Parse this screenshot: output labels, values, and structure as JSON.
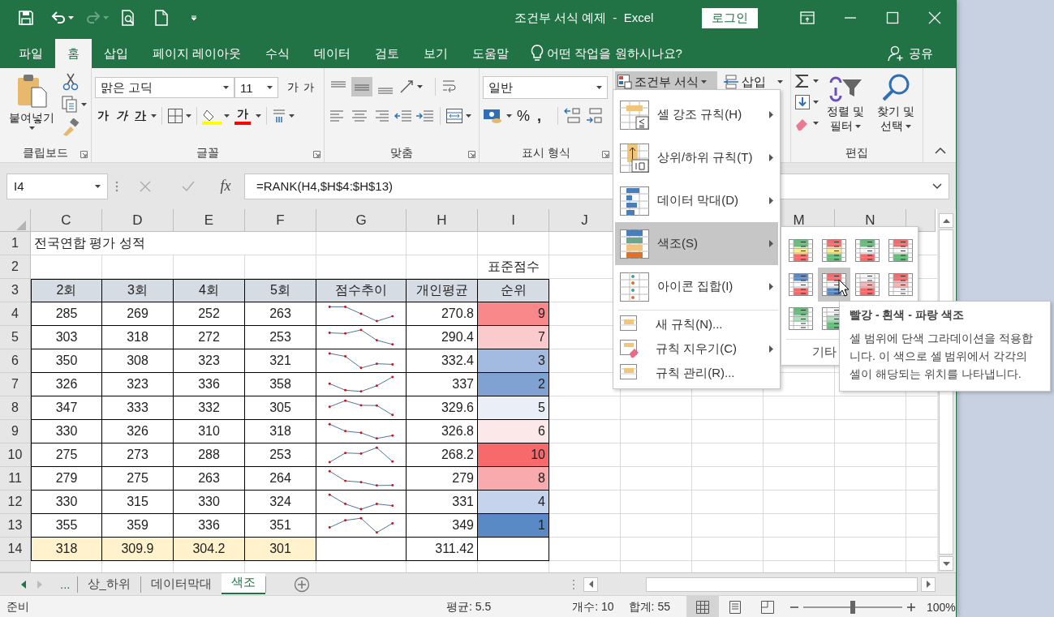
{
  "window": {
    "title": "조건부 서식 예제  -  Excel",
    "login_button": "로그인"
  },
  "ribbon_tabs": [
    {
      "label": "파일",
      "selected": false
    },
    {
      "label": "홈",
      "selected": true
    },
    {
      "label": "삽입",
      "selected": false
    },
    {
      "label": "페이지 레이아웃",
      "selected": false
    },
    {
      "label": "수식",
      "selected": false
    },
    {
      "label": "데이터",
      "selected": false
    },
    {
      "label": "검토",
      "selected": false
    },
    {
      "label": "보기",
      "selected": false
    },
    {
      "label": "도움말",
      "selected": false
    }
  ],
  "tell_me": "어떤 작업을 원하시나요?",
  "share": "공유",
  "ribbon": {
    "clipboard": {
      "paste": "붙여넣기",
      "label": "클립보드"
    },
    "font": {
      "font_name": "맑은 고딕",
      "font_size": "11",
      "grow": "가",
      "shrink": "가",
      "bold": "가",
      "italic": "가",
      "underline": "가",
      "font_color": "가",
      "label": "글꼴"
    },
    "alignment": {
      "label": "맞춤"
    },
    "number": {
      "format": "일반",
      "percent": "%",
      "comma": ",",
      "label": "표시 형식"
    },
    "styles": {
      "conditional_formatting": "조건부 서식",
      "pressed": true
    },
    "cells": {
      "insert": "삽입"
    },
    "editing": {
      "sort_filter": "정렬 및 필터",
      "find_select": "찾기 및 선택",
      "label": "편집"
    }
  },
  "formula_bar": {
    "name_box": "I4",
    "fx": "fx",
    "formula": "=RANK(H4,$H$4:$H$13)"
  },
  "sheet": {
    "column_headers": [
      "C",
      "D",
      "E",
      "F",
      "G",
      "H",
      "I",
      "J",
      "M",
      "N"
    ],
    "row_headers": [
      "1",
      "2",
      "3",
      "4",
      "5",
      "6",
      "7",
      "8",
      "9",
      "10",
      "11",
      "12",
      "13",
      "14"
    ],
    "title": "전국연합 평가 성적",
    "caption": "표준점수",
    "headers": [
      "2회",
      "3회",
      "4회",
      "5회",
      "점수추이",
      "개인평균",
      "순위"
    ],
    "rows": [
      {
        "scores": [
          "285",
          "269",
          "252",
          "263"
        ],
        "average": "270.8",
        "rank": "9",
        "color": "#f8888a"
      },
      {
        "scores": [
          "303",
          "318",
          "272",
          "253"
        ],
        "average": "290.4",
        "rank": "7",
        "color": "#fbcacc"
      },
      {
        "scores": [
          "350",
          "308",
          "323",
          "321"
        ],
        "average": "332.4",
        "rank": "3",
        "color": "#a3bbe0"
      },
      {
        "scores": [
          "326",
          "323",
          "336",
          "358"
        ],
        "average": "337",
        "rank": "2",
        "color": "#7fa2d2"
      },
      {
        "scores": [
          "347",
          "333",
          "332",
          "305"
        ],
        "average": "329.6",
        "rank": "5",
        "color": "#e9eef7"
      },
      {
        "scores": [
          "330",
          "326",
          "310",
          "318"
        ],
        "average": "326.8",
        "rank": "6",
        "color": "#fce7e9"
      },
      {
        "scores": [
          "275",
          "273",
          "288",
          "253"
        ],
        "average": "268.2",
        "rank": "10",
        "color": "#f8696b"
      },
      {
        "scores": [
          "279",
          "275",
          "263",
          "264"
        ],
        "average": "279",
        "rank": "8",
        "color": "#f9aaac"
      },
      {
        "scores": [
          "330",
          "315",
          "330",
          "324"
        ],
        "average": "331",
        "rank": "4",
        "color": "#c5d4ec"
      },
      {
        "scores": [
          "355",
          "359",
          "336",
          "351"
        ],
        "average": "349",
        "rank": "1",
        "color": "#5a8ac6"
      }
    ],
    "totals": {
      "scores": [
        "318",
        "309.9",
        "304.2",
        "301"
      ],
      "average": "311.42"
    }
  },
  "conditional_menu": {
    "items": [
      {
        "label": "셀 강조 규칙(H)",
        "kind": "large",
        "submenu": true,
        "selected": false
      },
      {
        "label": "상위/하위 규칙(T)",
        "kind": "large",
        "submenu": true,
        "selected": false
      },
      {
        "label": "데이터 막대(D)",
        "kind": "large",
        "submenu": true,
        "selected": false
      },
      {
        "label": "색조(S)",
        "kind": "large",
        "submenu": true,
        "selected": true
      },
      {
        "label": "아이콘 집합(I)",
        "kind": "large",
        "submenu": true,
        "selected": false
      },
      {
        "label": "새 규칙(N)...",
        "kind": "small",
        "submenu": false,
        "selected": false
      },
      {
        "label": "규칙 지우기(C)",
        "kind": "small",
        "submenu": true,
        "selected": false
      },
      {
        "label": "규칙 관리(R)...",
        "kind": "small",
        "submenu": false,
        "selected": false
      }
    ]
  },
  "color_scales": {
    "swatches": [
      {
        "bands": [
          {
            "color": "#63be7b"
          },
          {
            "color": "#ffeb84"
          },
          {
            "color": "#f8696b"
          }
        ],
        "selected": false
      },
      {
        "bands": [
          {
            "color": "#f8696b"
          },
          {
            "color": "#ffeb84"
          },
          {
            "color": "#63be7b"
          }
        ],
        "selected": false
      },
      {
        "bands": [
          {
            "color": "#63be7b"
          },
          {
            "color": "#fcfcff"
          },
          {
            "color": "#f8696b"
          }
        ],
        "selected": false
      },
      {
        "bands": [
          {
            "color": "#f8696b"
          },
          {
            "color": "#fcfcff"
          },
          {
            "color": "#63be7b"
          }
        ],
        "selected": false
      },
      {
        "bands": [
          {
            "color": "#5a8ac6"
          },
          {
            "color": "#fcfcff"
          },
          {
            "color": "#f8696b"
          }
        ],
        "selected": false
      },
      {
        "bands": [
          {
            "color": "#f8696b"
          },
          {
            "color": "#fcfcff"
          },
          {
            "color": "#5a8ac6"
          }
        ],
        "selected": true
      },
      {
        "bands": [
          {
            "color": "#fcfcff"
          },
          {
            "color": "#fab4b5"
          },
          {
            "color": "#f8696b"
          }
        ],
        "selected": false
      },
      {
        "bands": [
          {
            "color": "#f8696b"
          },
          {
            "color": "#fab4b5"
          },
          {
            "color": "#fcfcff"
          }
        ],
        "selected": false
      },
      {
        "bands": [
          {
            "color": "#63be7b"
          },
          {
            "color": "#b0dfbd"
          },
          {
            "color": "#fcfcff"
          }
        ],
        "selected": false
      },
      {
        "bands": [
          {
            "color": "#fcfcff"
          },
          {
            "color": "#b0dfbd"
          },
          {
            "color": "#63be7b"
          }
        ],
        "selected": false
      }
    ],
    "more": "기타"
  },
  "tooltip": {
    "title": "빨강 - 흰색 - 파랑 색조",
    "body": "셀 범위에 단색 그라데이션을 적용합니다. 이 색으로 셀 범위에서 각각의 셀이 해당되는 위치를 나타냅니다."
  },
  "sheet_tabs": {
    "more": "...",
    "tabs": [
      {
        "label": "상_하위",
        "selected": false
      },
      {
        "label": "데이터막대",
        "selected": false
      },
      {
        "label": "색조",
        "selected": true
      }
    ]
  },
  "status_bar": {
    "ready": "준비",
    "average": "평균: 5.5",
    "count": "개수: 10",
    "sum": "합계: 55",
    "views": [
      {
        "kind": "normal",
        "selected": true
      },
      {
        "kind": "page_layout",
        "selected": false
      },
      {
        "kind": "page_break",
        "selected": false
      }
    ],
    "zoom": {
      "level": 0.5,
      "label": "100%"
    }
  }
}
